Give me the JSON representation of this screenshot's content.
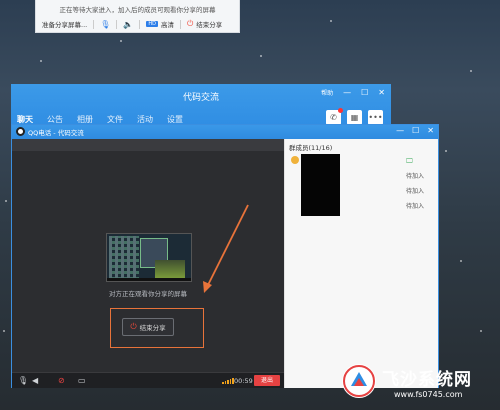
{
  "notice": {
    "message": "正在等待大家进入，加入后的成员可观看你分享的屏幕",
    "preparing": "准备分享屏幕...",
    "hd_badge": "HD",
    "quality": "高清",
    "end_share": "结束分享"
  },
  "group_window": {
    "title": "代码交流",
    "help": "帮助",
    "tabs": [
      "聊天",
      "公告",
      "相册",
      "文件",
      "活动",
      "设置"
    ]
  },
  "call_window": {
    "title": "QQ电话 - 代码交流",
    "watching_text": "对方正在观看你分享的屏幕",
    "end_share_button": "结束分享",
    "timer": "00:59",
    "exit_button": "退出"
  },
  "members": {
    "header": "群成员(11/16)",
    "statuses": [
      "待加入",
      "待加入",
      "待加入"
    ]
  },
  "watermark": {
    "site_name": "飞沙系统网",
    "url": "www.fs0745.com"
  },
  "colors": {
    "accent": "#2f8de3",
    "highlight_box": "#e8733a",
    "exit": "#e64242"
  },
  "icons": [
    "mic-icon",
    "speaker-icon",
    "camera-off-icon",
    "screen-share-icon",
    "power-icon",
    "phone-icon",
    "calendar-icon",
    "more-icon",
    "minimize-icon",
    "maximize-icon",
    "close-icon"
  ]
}
